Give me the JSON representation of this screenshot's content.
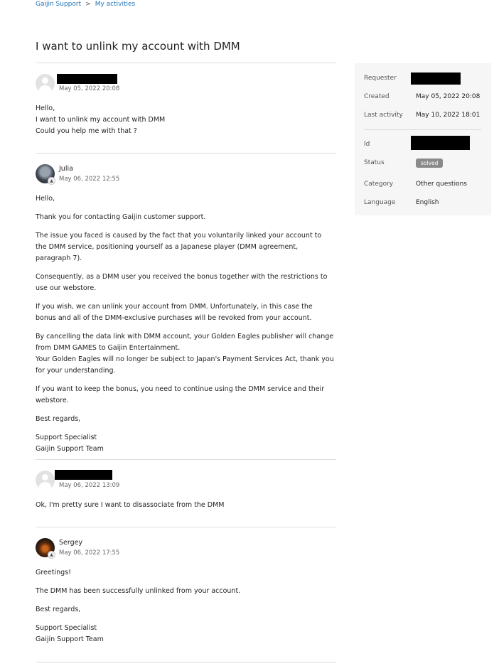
{
  "breadcrumb": {
    "home": "Gaijin Support",
    "separator": ">",
    "current": "My activities"
  },
  "title": "I want to unlink my account with DMM",
  "comments": [
    {
      "author": "",
      "timestamp": "May 05, 2022 20:08",
      "paragraphs": [
        "Hello,\nI want to unlink my account with DMM\nCould you help me with that ?"
      ]
    },
    {
      "author": "Julia",
      "timestamp": "May 06, 2022 12:55",
      "paragraphs": [
        "Hello,",
        "Thank you for contacting Gaijin customer support.",
        "The issue you faced is caused by the fact that you voluntarily linked your account to the DMM service, positioning yourself as a Japanese player (DMM agreement, paragraph 7).",
        "Consequently, as a DMM user you received the bonus together with the restrictions to use our webstore.",
        "If you wish, we can unlink your account from DMM. Unfortunately, in this case the bonus and all of the DMM-exclusive purchases will be revoked from your account.",
        "By cancelling the data link with DMM account, your Golden Eagles publisher will change from DMM GAMES to Gaijin Entertainment.\nYour Golden Eagles will no longer be subject to Japan's Payment Services Act, thank you for your understanding.",
        "If you want to keep the bonus, you need to continue using the DMM service and their webstore.",
        "Best regards,",
        "Support Specialist\nGaijin Support Team"
      ]
    },
    {
      "author": "",
      "timestamp": "May 06, 2022 13:09",
      "paragraphs": [
        "Ok, I'm pretty sure I want to disassociate from the DMM"
      ]
    },
    {
      "author": "Sergey",
      "timestamp": "May 06, 2022 17:55",
      "paragraphs": [
        "Greetings!",
        "The DMM has been successfully unlinked from your account.",
        "Best regards,",
        "Support Specialist\nGaijin Support Team"
      ]
    }
  ],
  "sidebar": {
    "requester_label": "Requester",
    "created_label": "Created",
    "created_value": "May 05, 2022 20:08",
    "last_activity_label": "Last activity",
    "last_activity_value": "May 10, 2022 18:01",
    "id_label": "Id",
    "status_label": "Status",
    "status_value": "solved",
    "category_label": "Category",
    "category_value": "Other questions",
    "language_label": "Language",
    "language_value": "English"
  },
  "colors": {
    "link": "#1f73b7",
    "status_badge": "#8a8a8a",
    "sidebar_bg": "#f6f6f6"
  }
}
